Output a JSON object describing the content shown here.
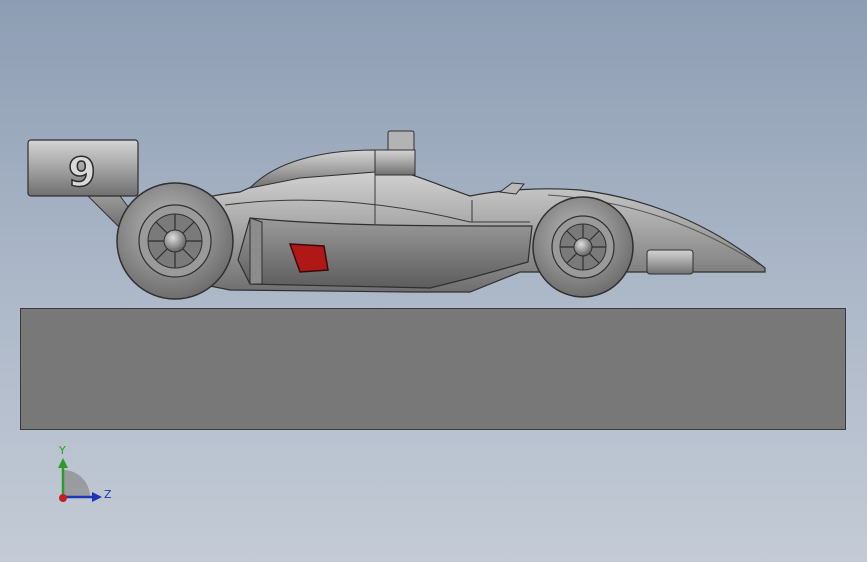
{
  "model": {
    "car_number": "9",
    "body_color": "#a8a8a8",
    "sidepod_accent_color": "#b01717",
    "base_color": "#787878"
  },
  "triad": {
    "y_label": "Y",
    "z_label": "Z",
    "y_color": "#2e9a2e",
    "z_color": "#1f35b8",
    "x_color": "#c41e1e"
  }
}
